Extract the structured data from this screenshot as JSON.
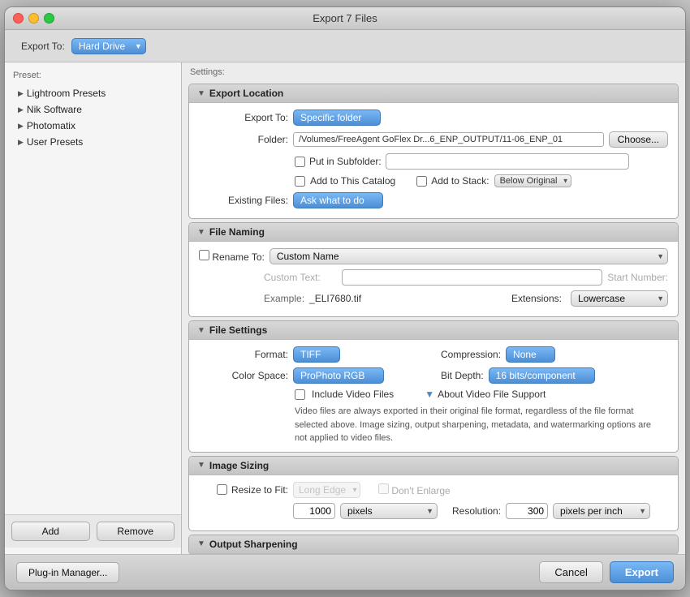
{
  "window": {
    "title": "Export 7 Files",
    "export_to_label": "Export To:",
    "export_to_value": "Hard Drive"
  },
  "sidebar": {
    "header": "Preset:",
    "items": [
      {
        "label": "Lightroom Presets",
        "id": "lightroom-presets"
      },
      {
        "label": "Nik Software",
        "id": "nik-software"
      },
      {
        "label": "Photomatix",
        "id": "photomatix"
      },
      {
        "label": "User Presets",
        "id": "user-presets"
      }
    ],
    "add_label": "Add",
    "remove_label": "Remove"
  },
  "settings": {
    "header": "Settings:",
    "export_location": {
      "title": "Export Location",
      "export_to_label": "Export To:",
      "export_to_value": "Specific folder",
      "folder_label": "Folder:",
      "folder_path": "/Volumes/FreeAgent GoFlex Dr...6_ENP_OUTPUT/11-06_ENP_01",
      "choose_label": "Choose...",
      "put_in_subfolder_label": "Put in Subfolder:",
      "add_to_catalog_label": "Add to This Catalog",
      "add_to_stack_label": "Add to Stack:",
      "below_original_label": "Below Original",
      "existing_files_label": "Existing Files:",
      "existing_files_value": "Ask what to do"
    },
    "file_naming": {
      "title": "File Naming",
      "rename_to_label": "Rename To:",
      "rename_to_value": "Custom Name",
      "custom_text_label": "Custom Text:",
      "start_number_label": "Start Number:",
      "example_label": "Example:",
      "example_value": "_ELI7680.tif",
      "extensions_label": "Extensions:",
      "extensions_value": "Lowercase"
    },
    "file_settings": {
      "title": "File Settings",
      "format_label": "Format:",
      "format_value": "TIFF",
      "compression_label": "Compression:",
      "compression_value": "None",
      "color_space_label": "Color Space:",
      "color_space_value": "ProPhoto RGB",
      "bit_depth_label": "Bit Depth:",
      "bit_depth_value": "16 bits/component",
      "include_video_label": "Include Video Files",
      "about_video_label": "About Video File Support",
      "video_text": "Video files are always exported in their original file format, regardless of the file format selected above. Image sizing, output sharpening, metadata, and watermarking options are not applied to video files."
    },
    "image_sizing": {
      "title": "Image Sizing",
      "resize_to_fit_label": "Resize to Fit:",
      "resize_to_fit_value": "Long Edge",
      "dont_enlarge_label": "Don't Enlarge",
      "size_value": "1000",
      "size_unit": "pixels",
      "resolution_label": "Resolution:",
      "resolution_value": "300",
      "resolution_unit": "pixels per inch"
    },
    "output_sharpening": {
      "title": "Output Sharpening"
    }
  },
  "bottom_bar": {
    "plugin_manager_label": "Plug-in Manager...",
    "cancel_label": "Cancel",
    "export_label": "Export"
  }
}
